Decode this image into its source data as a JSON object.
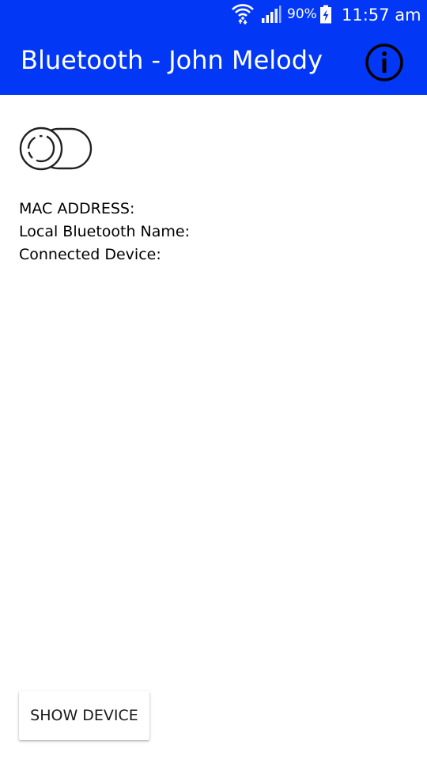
{
  "status_bar": {
    "battery_percent": "90%",
    "time": "11:57 am",
    "icons": [
      "wifi-icon",
      "cell-signal-icon",
      "battery-charging-icon"
    ]
  },
  "app_bar": {
    "title": "Bluetooth - John Melody",
    "action_icon": "info-icon"
  },
  "bluetooth_toggle": {
    "state": "off"
  },
  "info": {
    "mac_address_label": "MAC ADDRESS:",
    "local_name_label": "Local Bluetooth Name:",
    "connected_device_label": "Connected Device:"
  },
  "actions": {
    "show_device_label": "SHOW DEVICE"
  },
  "colors": {
    "primary": "#0238f5",
    "background": "#ffffff",
    "text": "#000000"
  }
}
